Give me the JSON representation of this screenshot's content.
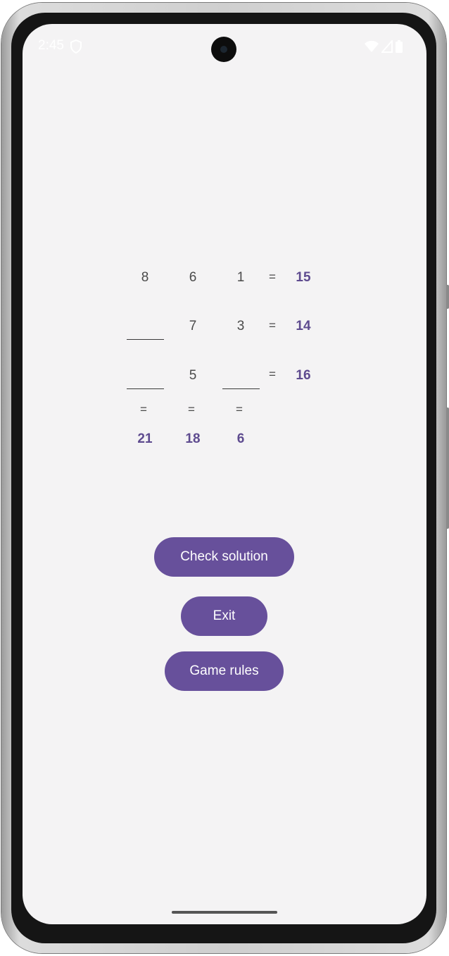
{
  "status_bar": {
    "time": "2:45",
    "icons": [
      "shield-icon",
      "wifi-icon",
      "signal-icon",
      "battery-icon"
    ]
  },
  "puzzle": {
    "rows": [
      {
        "cells": [
          "8",
          "6",
          "1"
        ],
        "equals": "=",
        "result": "15"
      },
      {
        "cells": [
          "",
          "7",
          "3"
        ],
        "equals": "=",
        "result": "14"
      },
      {
        "cells": [
          "",
          "5",
          ""
        ],
        "equals": "=",
        "result": "16"
      }
    ],
    "column_equals": [
      "=",
      "=",
      "="
    ],
    "column_results": [
      "21",
      "18",
      "6"
    ]
  },
  "buttons": {
    "check_solution": "Check solution",
    "exit": "Exit",
    "game_rules": "Game rules"
  },
  "colors": {
    "accent": "#67509b",
    "result_text": "#5e4b8f",
    "screen_bg": "#f4f3f4"
  }
}
